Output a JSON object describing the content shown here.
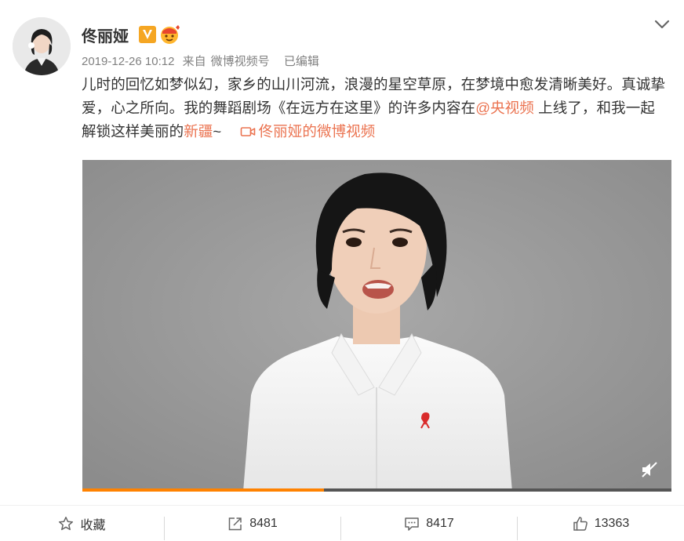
{
  "post": {
    "author": "佟丽娅",
    "verified_badge": "V",
    "timestamp": "2019-12-26 10:12",
    "source_prefix": "来自",
    "source": "微博视频号",
    "edited": "已编辑",
    "text_part1": "儿时的回忆如梦似幻，家乡的山川河流，浪漫的星空草原，在梦境中愈发清晰美好。真诚挚爱，心之所向。我的舞蹈剧场《在远方在这里》的许多内容在",
    "mention": "@央视频",
    "text_part2": " 上线了，和我一起解锁这样美丽的",
    "tag": "新疆",
    "text_part3": "~",
    "video_link": "佟丽娅的微博视频"
  },
  "video": {
    "progress_percent": 41,
    "muted": true
  },
  "actions": {
    "favorite": "收藏",
    "repost": "8481",
    "comment": "8417",
    "like": "13363"
  },
  "colors": {
    "link": "#eb7350",
    "progress": "#ff8200",
    "verified": "#f5a623"
  },
  "icons": [
    "chevron-down-icon",
    "verified-icon",
    "emoji-badge-icon",
    "video-camera-icon",
    "mute-icon",
    "star-icon",
    "repost-icon",
    "comment-icon",
    "like-icon"
  ]
}
